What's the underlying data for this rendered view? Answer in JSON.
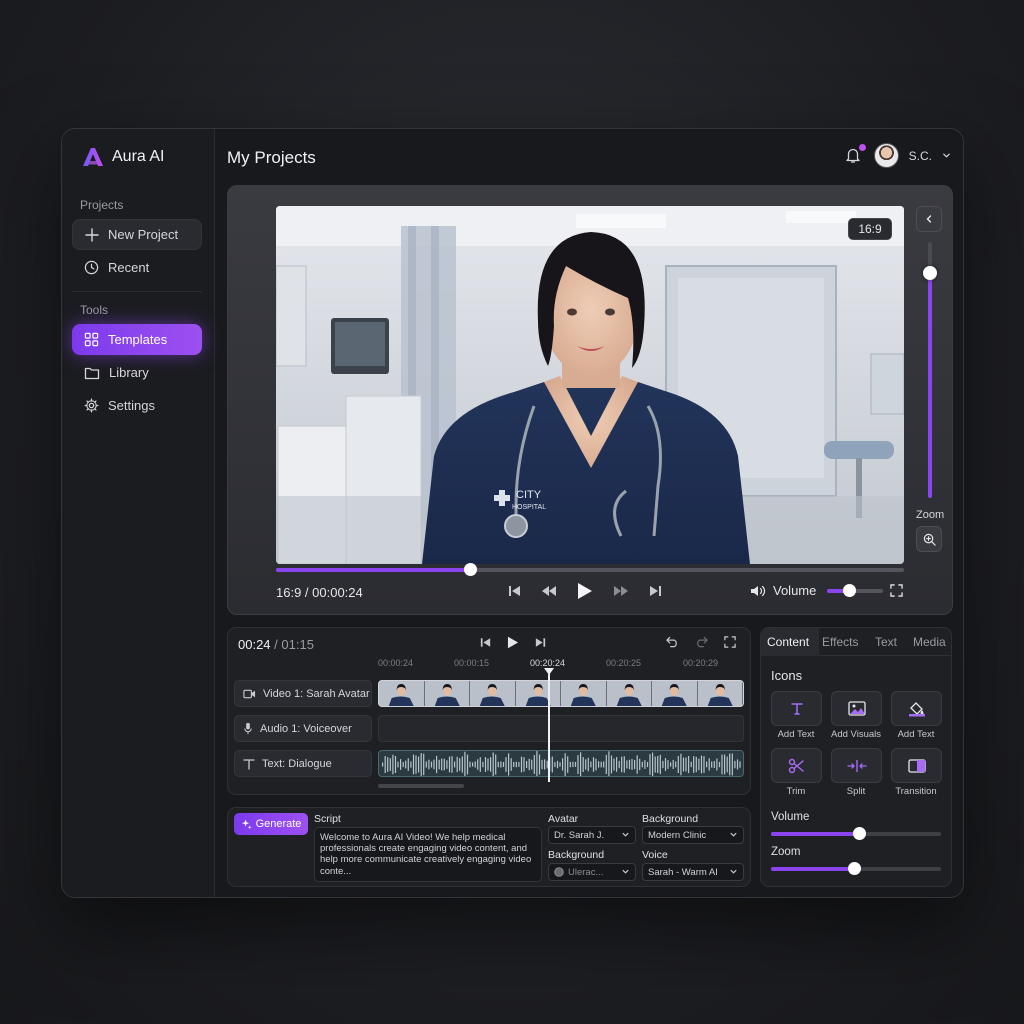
{
  "brand": {
    "name": "Aura AI",
    "accent": "#8b45ef"
  },
  "sidebar": {
    "projects_label": "Projects",
    "tools_label": "Tools",
    "items": [
      {
        "label": "New Project",
        "icon": "plus-icon"
      },
      {
        "label": "Recent",
        "icon": "clock-icon"
      },
      {
        "label": "Templates",
        "icon": "grid-icon",
        "active": true
      },
      {
        "label": "Library",
        "icon": "folder-icon"
      },
      {
        "label": "Settings",
        "icon": "gear-icon"
      }
    ]
  },
  "header": {
    "title": "My Projects",
    "user": "S.C.",
    "notification_badge": true
  },
  "preview": {
    "aspect_badge": "16:9",
    "badge_text": "CITY HOSPITAL",
    "zoom_label": "Zoom",
    "zoom_level": 0.88,
    "time_readout": "16:9 / 00:00:24",
    "progress": 0.31,
    "volume_label": "Volume",
    "volume_level": 0.4
  },
  "timeline": {
    "current": "00:24",
    "total": "/ 01:15",
    "ticks": [
      "00:00:24",
      "00:00:15",
      "00:20:24",
      "00:20:25",
      "00:20:29"
    ],
    "active_tick": 2,
    "tracks": [
      {
        "label": "Video 1: Sarah Avatar",
        "icon": "video-icon"
      },
      {
        "label": "Audio 1: Voiceover",
        "icon": "mic-icon"
      },
      {
        "label": "Text: Dialogue",
        "icon": "text-icon"
      }
    ]
  },
  "generate": {
    "button": "Generate",
    "script_label": "Script",
    "script_text": "Welcome to Aura AI Video! We help medical professionals create engaging video content, and help more communicate creatively engaging video conte...",
    "avatar_label": "Avatar",
    "avatar_value": "Dr. Sarah J.",
    "background_label": "Background",
    "background_value": "Modern Clinic",
    "background2_label": "Background",
    "background2_value": "Ulerac...",
    "voice_label": "Voice",
    "voice_value": "Sarah - Warm AI"
  },
  "panel": {
    "tabs": [
      "Content",
      "Effects",
      "Text",
      "Media"
    ],
    "heading": "Icons",
    "tools": [
      {
        "label": "Add Text",
        "icon": "text-tool-icon"
      },
      {
        "label": "Add Visuals",
        "icon": "image-icon"
      },
      {
        "label": "Add Text",
        "icon": "paint-bucket-icon"
      },
      {
        "label": "Trim",
        "icon": "scissors-icon"
      },
      {
        "label": "Split",
        "icon": "split-icon"
      },
      {
        "label": "Transition",
        "icon": "transition-icon"
      }
    ],
    "volume_label": "Volume",
    "volume_level": 0.52,
    "zoom_label": "Zoom",
    "zoom_level": 0.49
  }
}
